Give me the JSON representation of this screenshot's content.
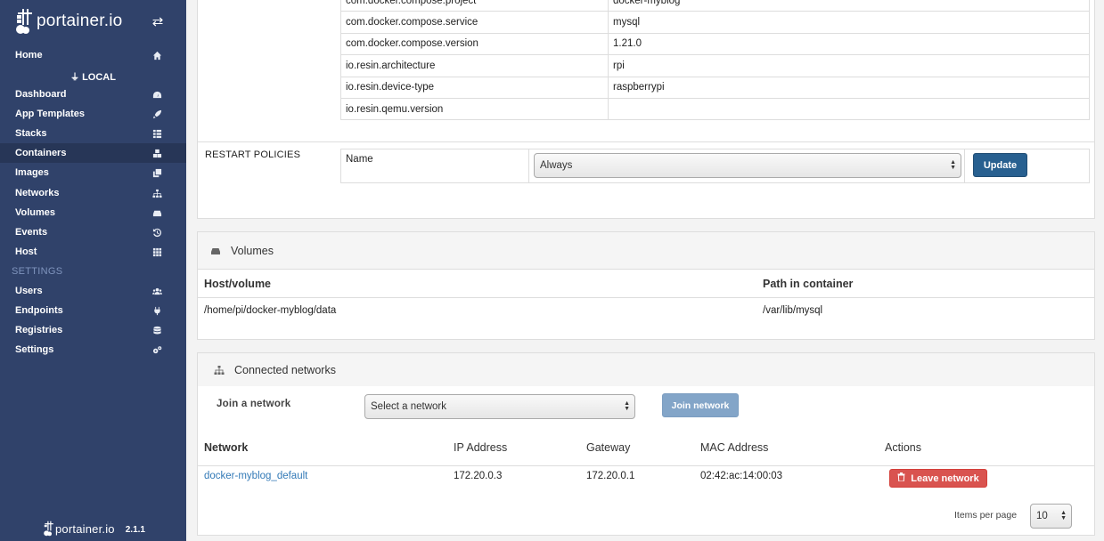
{
  "sidebar": {
    "brand": "portainer.io",
    "endpoint_heading": "LOCAL",
    "settings_heading": "SETTINGS",
    "items": [
      {
        "label": "Home",
        "icon": "home-icon"
      },
      {
        "label": "Dashboard",
        "icon": "tachometer-icon"
      },
      {
        "label": "App Templates",
        "icon": "rocket-icon"
      },
      {
        "label": "Stacks",
        "icon": "th-list-icon"
      },
      {
        "label": "Containers",
        "icon": "cubes-icon"
      },
      {
        "label": "Images",
        "icon": "clone-icon"
      },
      {
        "label": "Networks",
        "icon": "sitemap-icon"
      },
      {
        "label": "Volumes",
        "icon": "hdd-icon"
      },
      {
        "label": "Events",
        "icon": "history-icon"
      },
      {
        "label": "Host",
        "icon": "th-icon"
      },
      {
        "label": "Users",
        "icon": "users-icon"
      },
      {
        "label": "Endpoints",
        "icon": "plug-icon"
      },
      {
        "label": "Registries",
        "icon": "database-icon"
      },
      {
        "label": "Settings",
        "icon": "cogs-icon"
      }
    ],
    "active_item": "Containers",
    "footer": {
      "brand": "portainer.io",
      "version": "2.1.1"
    }
  },
  "labels_table": {
    "rows": [
      {
        "key": "com.docker.compose.project",
        "value": "docker-myblog"
      },
      {
        "key": "com.docker.compose.service",
        "value": "mysql"
      },
      {
        "key": "com.docker.compose.version",
        "value": "1.21.0"
      },
      {
        "key": "io.resin.architecture",
        "value": "rpi"
      },
      {
        "key": "io.resin.device-type",
        "value": "raspberrypi"
      },
      {
        "key": "io.resin.qemu.version",
        "value": ""
      }
    ]
  },
  "restart_policies": {
    "label": "RESTART POLICIES",
    "name_label": "Name",
    "selected": "Always",
    "update_button": "Update"
  },
  "volumes": {
    "title": "Volumes",
    "headers": [
      "Host/volume",
      "Path in container"
    ],
    "rows": [
      {
        "host": "/home/pi/docker-myblog/data",
        "path": "/var/lib/mysql"
      }
    ]
  },
  "networks": {
    "title": "Connected networks",
    "join_label": "Join a network",
    "select_placeholder": "Select a network",
    "join_button": "Join network",
    "headers": [
      "Network",
      "IP Address",
      "Gateway",
      "MAC Address",
      "Actions"
    ],
    "rows": [
      {
        "network": "docker-myblog_default",
        "ip": "172.20.0.3",
        "gateway": "172.20.0.1",
        "mac": "02:42:ac:14:00:03",
        "action": "Leave network"
      }
    ],
    "items_per_page_label": "Items per page",
    "items_per_page": "10"
  }
}
